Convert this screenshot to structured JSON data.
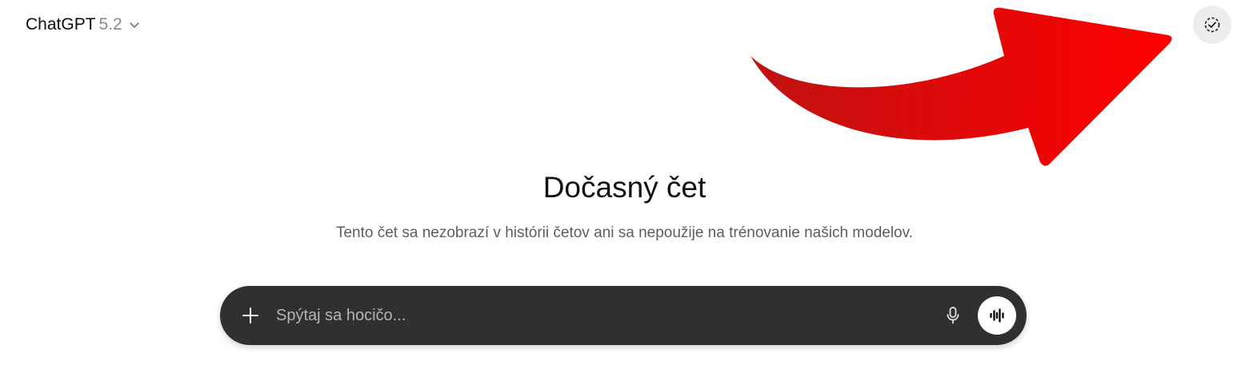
{
  "header": {
    "model_name": "ChatGPT",
    "model_version": "5.2",
    "chevron_icon": "chevron-down-icon",
    "temporary_chat_icon": "dashed-circle-check-icon"
  },
  "annotation": {
    "arrow_color": "#e60000",
    "arrow_icon": "red-arrow-annotation"
  },
  "main": {
    "title": "Dočasný čet",
    "subtitle": "Tento čet sa nezobrazí v histórii četov ani sa nepoužije na trénovanie našich modelov."
  },
  "composer": {
    "placeholder": "Spýtaj sa hocičo...",
    "value": "",
    "background": "#303030",
    "plus_icon": "plus-icon",
    "mic_icon": "microphone-icon",
    "voice_icon": "voice-waveform-icon"
  }
}
